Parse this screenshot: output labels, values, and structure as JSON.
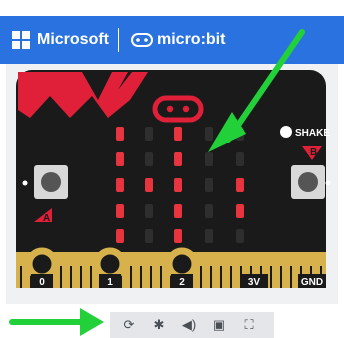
{
  "header": {
    "brand": "Microsoft",
    "product": "micro:bit",
    "bg_color": "#2a72e0"
  },
  "board": {
    "shake_label": "SHAKE",
    "button_a_label": "A",
    "button_b_label": "B",
    "pins": [
      "0",
      "1",
      "2",
      "3V",
      "GND"
    ],
    "led_matrix": [
      [
        1,
        0,
        1,
        0,
        0
      ],
      [
        1,
        0,
        1,
        0,
        0
      ],
      [
        1,
        1,
        1,
        0,
        1
      ],
      [
        1,
        0,
        1,
        0,
        1
      ],
      [
        1,
        0,
        1,
        0,
        0
      ]
    ],
    "colors": {
      "board": "#1a1a1a",
      "accent": "#e02038",
      "pin": "#d7b24c",
      "led_on": "#e8343f",
      "led_off": "#2e2e2e"
    }
  },
  "toolbar": {
    "buttons": [
      {
        "name": "restart-icon",
        "glyph": "⟳"
      },
      {
        "name": "debug-icon",
        "glyph": "✱"
      },
      {
        "name": "mute-audio-icon",
        "glyph": "◀)"
      },
      {
        "name": "screenshot-icon",
        "glyph": "▣"
      },
      {
        "name": "fullscreen-icon",
        "glyph": "⛶"
      }
    ]
  },
  "annotations": {
    "arrow_color": "#22d13a"
  }
}
